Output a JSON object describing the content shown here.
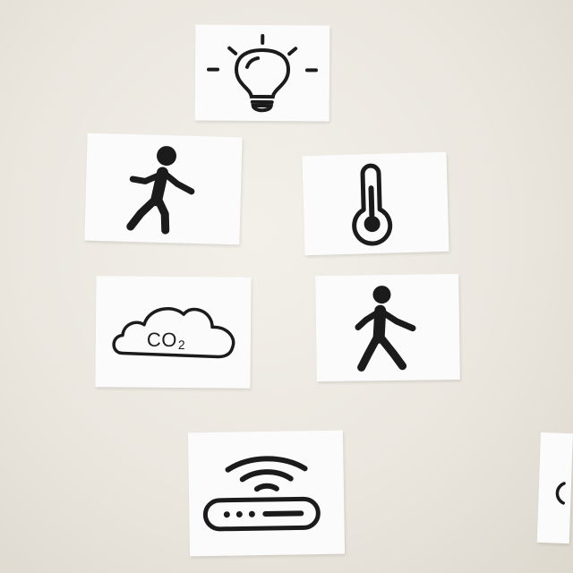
{
  "scene": {
    "background": "#ebe7df",
    "card_color": "#fbfbfb",
    "ink_color": "#1b1b1b"
  },
  "cards": [
    {
      "icon": "light-bulb-icon"
    },
    {
      "icon": "walking-person-icon"
    },
    {
      "icon": "thermometer-icon"
    },
    {
      "icon": "co2-cloud-icon",
      "text": "CO",
      "subscript": "2"
    },
    {
      "icon": "walking-person-icon"
    },
    {
      "icon": "wifi-router-icon"
    },
    {
      "icon": "partial-card-icon"
    }
  ]
}
